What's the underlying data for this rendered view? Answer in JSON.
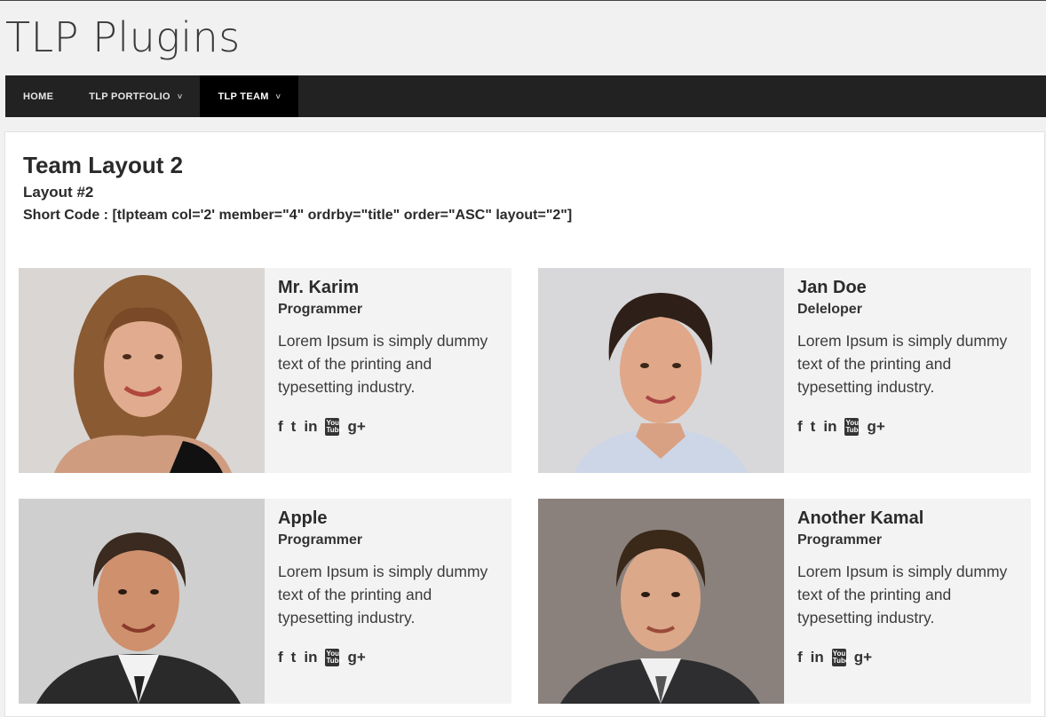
{
  "site": {
    "title": "TLP Plugins"
  },
  "nav": {
    "items": [
      {
        "label": "HOME",
        "dropdown": false,
        "active": false
      },
      {
        "label": "TLP PORTFOLIO",
        "dropdown": true,
        "active": false
      },
      {
        "label": "TLP TEAM",
        "dropdown": true,
        "active": true
      }
    ],
    "caret": "˅"
  },
  "page": {
    "title": "Team Layout 2",
    "subtitle": "Layout #2",
    "shortcode": "Short Code : [tlpteam col='2' member=\"4\" ordrby=\"title\" order=\"ASC\" layout=\"2\"]"
  },
  "members": [
    {
      "name": "Mr. Karim",
      "role": "Programmer",
      "description": "Lorem Ipsum is simply dummy text of the printing and typesetting industry.",
      "social": [
        "f",
        "t",
        "in",
        "You Tube",
        "g+"
      ]
    },
    {
      "name": "Jan Doe",
      "role": "Deleloper",
      "description": "Lorem Ipsum is simply dummy text of the printing and typesetting industry.",
      "social": [
        "f",
        "t",
        "in",
        "You Tube",
        "g+"
      ]
    },
    {
      "name": "Apple",
      "role": "Programmer",
      "description": "Lorem Ipsum is simply dummy text of the printing and typesetting industry.",
      "social": [
        "f",
        "t",
        "in",
        "You Tube",
        "g+"
      ]
    },
    {
      "name": "Another Kamal",
      "role": "Programmer",
      "description": "Lorem Ipsum is simply dummy text of the printing and typesetting industry.",
      "social": [
        "f",
        "in",
        "You Tube",
        "g+"
      ]
    }
  ],
  "colors": {
    "navbar": "#222222",
    "nav_active": "#000000",
    "card_bg": "#f3f3f3"
  }
}
